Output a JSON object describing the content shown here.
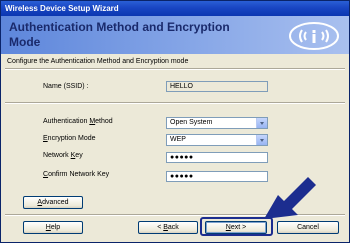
{
  "window": {
    "title": "Wireless Device Setup Wizard"
  },
  "header": {
    "title": "Authentication Method and Encryption Mode"
  },
  "subtitle": "Configure the Authentication Method and Encryption mode",
  "ssid": {
    "label": "Name (SSID) :",
    "value": "HELLO"
  },
  "auth": {
    "label_pre": "Authentication ",
    "label_key": "M",
    "label_post": "ethod",
    "value": "Open System"
  },
  "encryption": {
    "label_key": "E",
    "label_post": "ncryption Mode",
    "value": "WEP"
  },
  "network_key": {
    "label_pre": "Network ",
    "label_key": "K",
    "label_post": "ey",
    "value": "●●●●●"
  },
  "confirm_key": {
    "label_key": "C",
    "label_post": "onfirm Network Key",
    "value": "●●●●●"
  },
  "buttons": {
    "advanced_key": "A",
    "advanced_post": "dvanced",
    "help_key": "H",
    "help_post": "elp",
    "back_pre": "< ",
    "back_key": "B",
    "back_post": "ack",
    "next_key": "N",
    "next_post": "ext >",
    "cancel": "Cancel"
  },
  "colors": {
    "accent": "#1c2d8f",
    "header_start": "#5d86db",
    "header_end": "#a9c0ef"
  },
  "icons": {
    "logo": "wireless-logo-icon",
    "arrow": "pointer-arrow-icon"
  }
}
